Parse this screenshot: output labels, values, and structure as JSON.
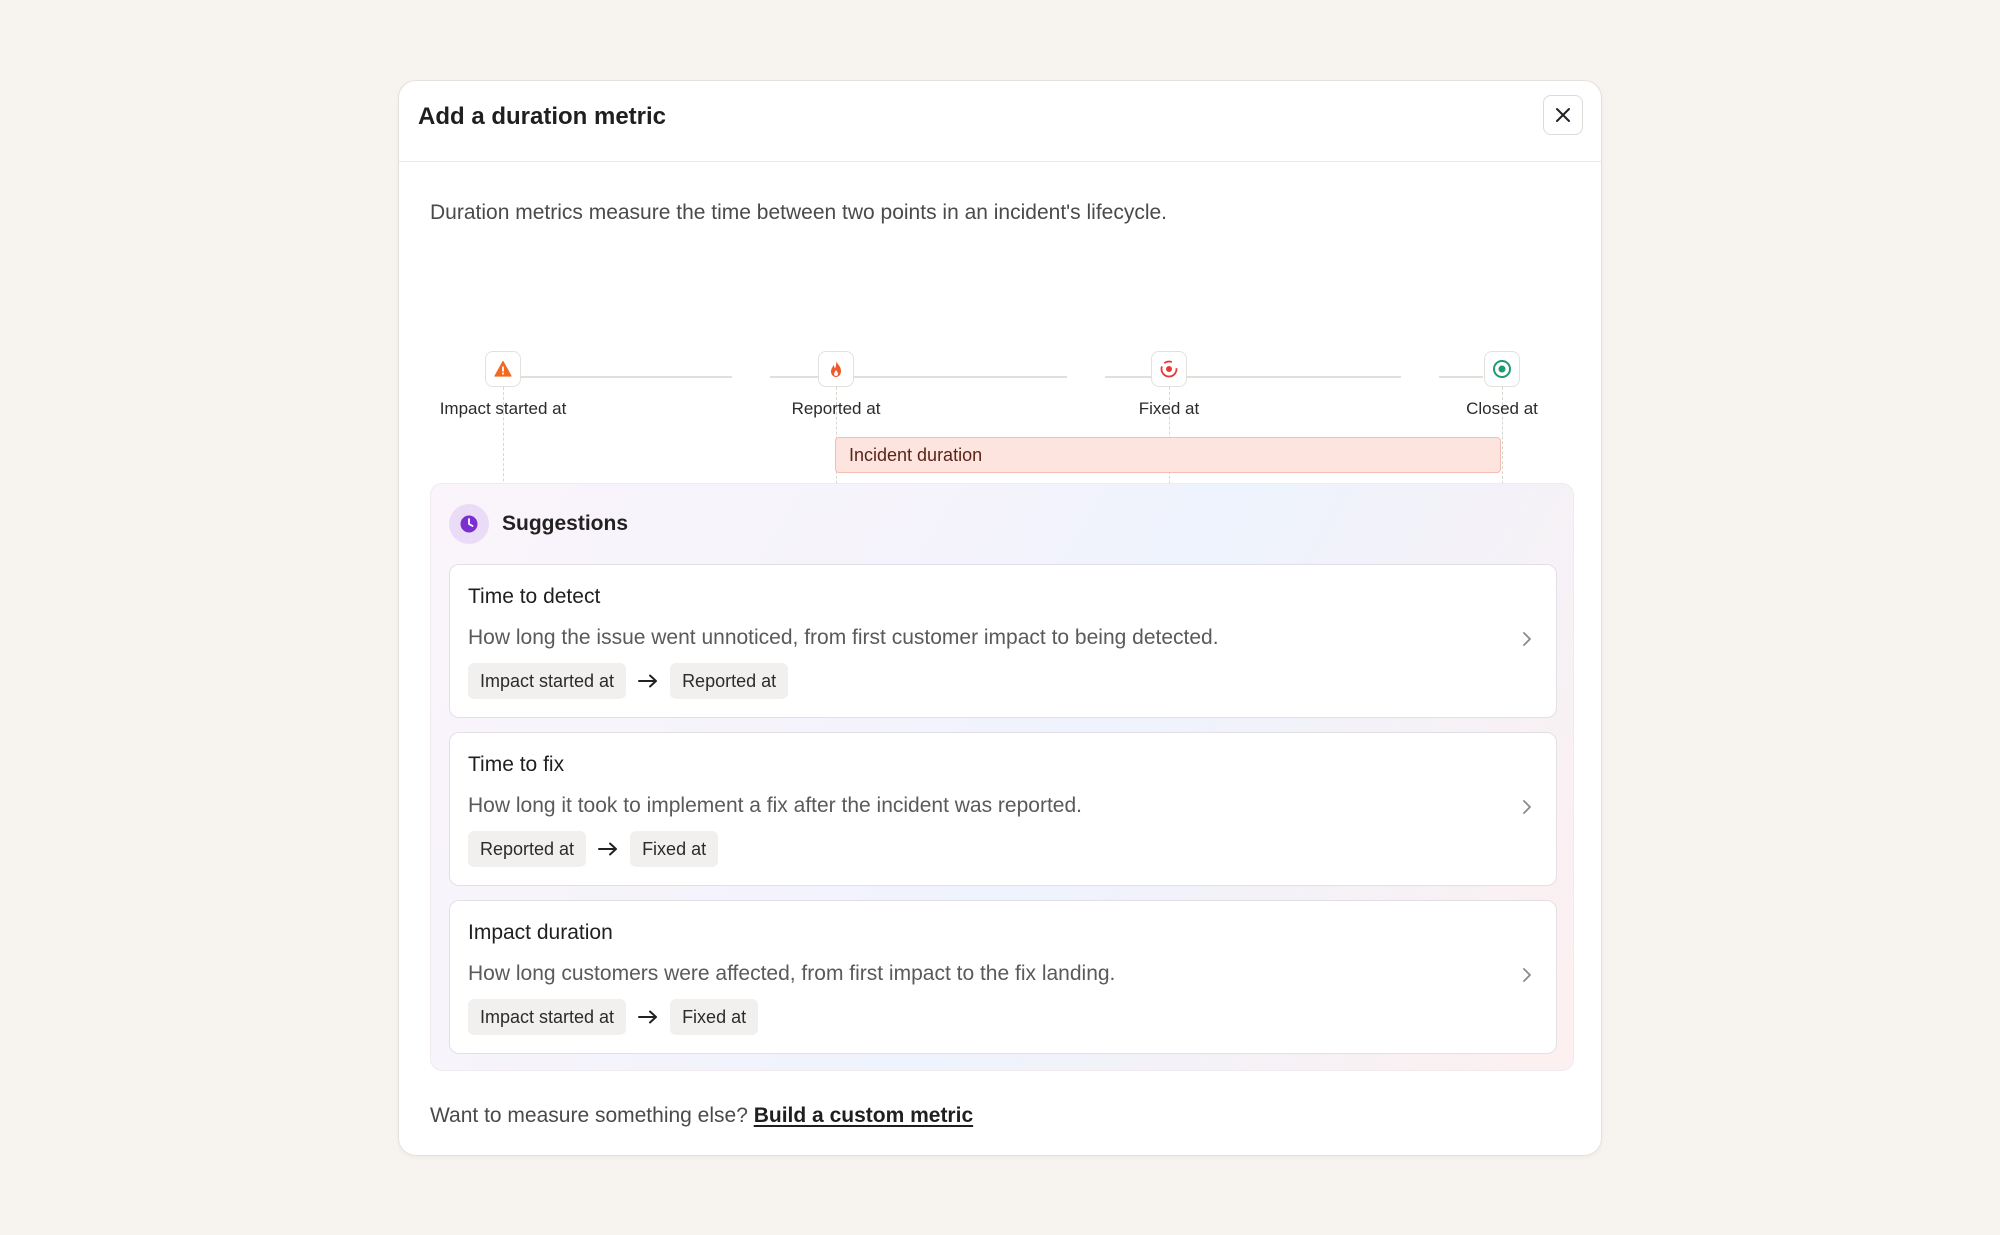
{
  "modal": {
    "title": "Add a duration metric",
    "close_icon": "close-icon",
    "intro": "Duration metrics measure the time between two points in an incident's lifecycle."
  },
  "timeline": {
    "points": [
      {
        "label": "Impact started at",
        "icon": "warning-icon",
        "color": "#f06b1f"
      },
      {
        "label": "Reported at",
        "icon": "flame-icon",
        "color": "#ef5a2a"
      },
      {
        "label": "Fixed at",
        "icon": "target-icon",
        "color": "#e53935"
      },
      {
        "label": "Closed at",
        "icon": "check-circle-icon",
        "color": "#1e9b72"
      }
    ],
    "duration_label": "Incident duration"
  },
  "suggestions": {
    "title": "Suggestions",
    "icon": "clock-icon",
    "icon_color": "#7b2fd0",
    "items": [
      {
        "title": "Time to detect",
        "description": "How long the issue went unnoticed, from first customer impact to being detected.",
        "from": "Impact started at",
        "to": "Reported at"
      },
      {
        "title": "Time to fix",
        "description": "How long it took to implement a fix after the incident was reported.",
        "from": "Reported at",
        "to": "Fixed at"
      },
      {
        "title": "Impact duration",
        "description": "How long customers were affected, from first impact to the fix landing.",
        "from": "Impact started at",
        "to": "Fixed at"
      }
    ]
  },
  "footer": {
    "prompt": "Want to measure something else?",
    "link": "Build a custom metric"
  }
}
